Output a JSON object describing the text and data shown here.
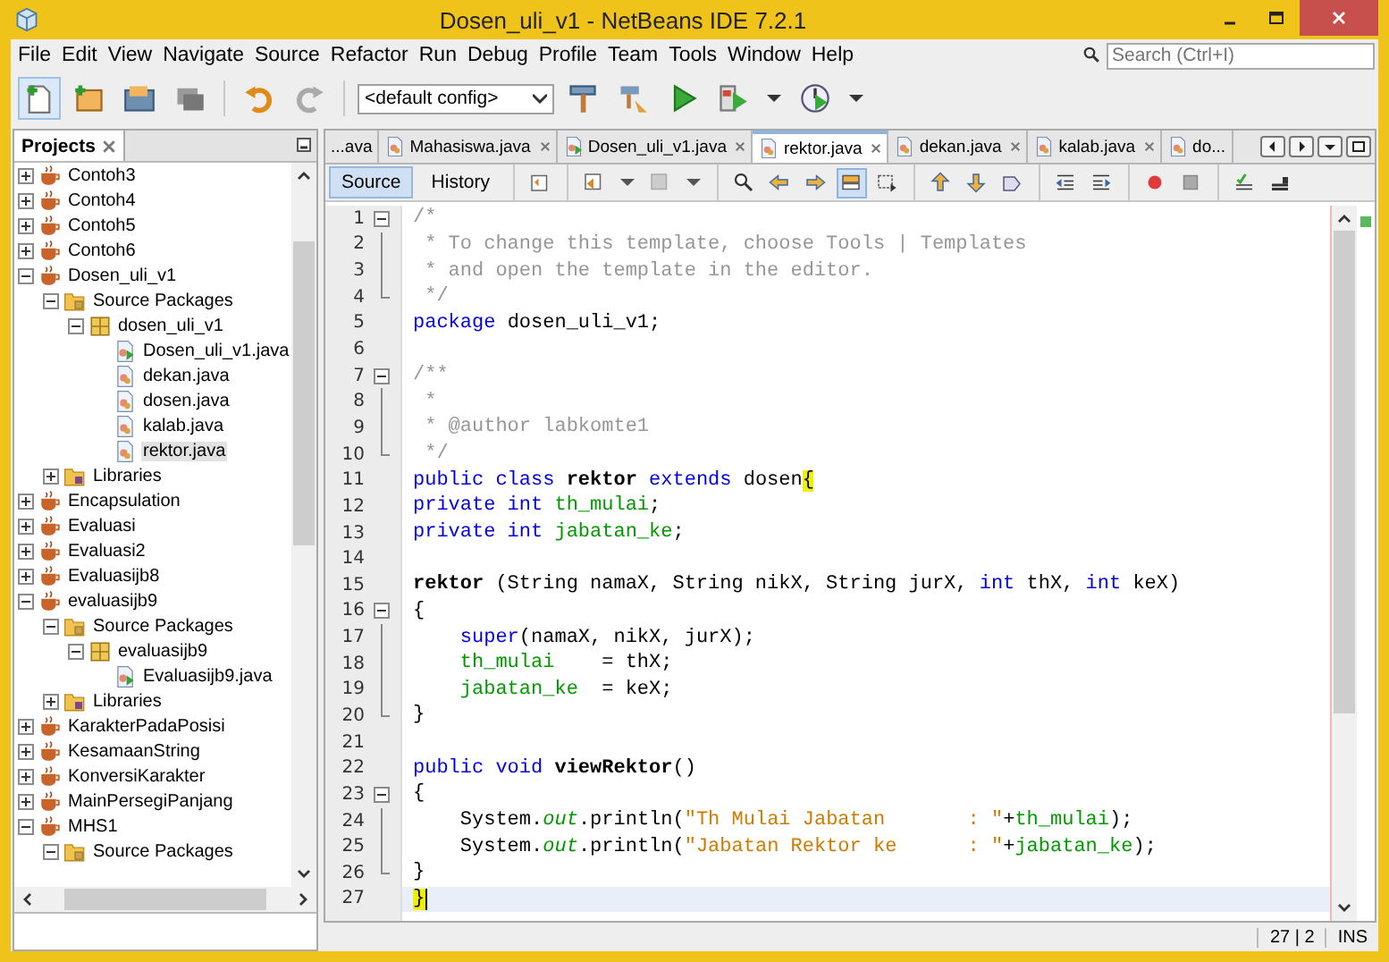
{
  "window": {
    "title": "Dosen_uli_v1 - NetBeans IDE 7.2.1"
  },
  "menu": [
    "File",
    "Edit",
    "View",
    "Navigate",
    "Source",
    "Refactor",
    "Run",
    "Debug",
    "Profile",
    "Team",
    "Tools",
    "Window",
    "Help"
  ],
  "search": {
    "placeholder": "Search (Ctrl+I)"
  },
  "toolbar": {
    "config": "<default config>"
  },
  "projects_panel": {
    "title": "Projects",
    "tree": [
      {
        "label": "Contoh3",
        "kind": "project",
        "expanded": false,
        "selected": false
      },
      {
        "label": "Contoh4",
        "kind": "project",
        "expanded": false,
        "selected": false
      },
      {
        "label": "Contoh5",
        "kind": "project",
        "expanded": false,
        "selected": false
      },
      {
        "label": "Contoh6",
        "kind": "project",
        "expanded": false,
        "selected": false
      },
      {
        "label": "Dosen_uli_v1",
        "kind": "project",
        "expanded": true,
        "selected": false,
        "children": [
          {
            "label": "Source Packages",
            "kind": "sources",
            "expanded": true,
            "selected": false,
            "children": [
              {
                "label": "dosen_uli_v1",
                "kind": "package",
                "expanded": true,
                "selected": false,
                "children": [
                  {
                    "label": "Dosen_uli_v1.java",
                    "kind": "main",
                    "selected": false
                  },
                  {
                    "label": "dekan.java",
                    "kind": "java",
                    "selected": false
                  },
                  {
                    "label": "dosen.java",
                    "kind": "java",
                    "selected": false
                  },
                  {
                    "label": "kalab.java",
                    "kind": "java",
                    "selected": false
                  },
                  {
                    "label": "rektor.java",
                    "kind": "java",
                    "selected": true
                  }
                ]
              }
            ]
          },
          {
            "label": "Libraries",
            "kind": "libraries",
            "expanded": false,
            "selected": false
          }
        ]
      },
      {
        "label": "Encapsulation",
        "kind": "project",
        "expanded": false,
        "selected": false
      },
      {
        "label": "Evaluasi",
        "kind": "project",
        "expanded": false,
        "selected": false
      },
      {
        "label": "Evaluasi2",
        "kind": "project",
        "expanded": false,
        "selected": false
      },
      {
        "label": "Evaluasijb8",
        "kind": "project",
        "expanded": false,
        "selected": false
      },
      {
        "label": "evaluasijb9",
        "kind": "project",
        "expanded": true,
        "selected": false,
        "children": [
          {
            "label": "Source Packages",
            "kind": "sources",
            "expanded": true,
            "selected": false,
            "children": [
              {
                "label": "evaluasijb9",
                "kind": "package",
                "expanded": true,
                "selected": false,
                "children": [
                  {
                    "label": "Evaluasijb9.java",
                    "kind": "main",
                    "selected": false
                  }
                ]
              }
            ]
          },
          {
            "label": "Libraries",
            "kind": "libraries",
            "expanded": false,
            "selected": false
          }
        ]
      },
      {
        "label": "KarakterPadaPosisi",
        "kind": "project",
        "expanded": false,
        "selected": false
      },
      {
        "label": "KesamaanString",
        "kind": "project",
        "expanded": false,
        "selected": false
      },
      {
        "label": "KonversiKarakter",
        "kind": "project",
        "expanded": false,
        "selected": false
      },
      {
        "label": "MainPersegiPanjang",
        "kind": "project",
        "expanded": false,
        "selected": false
      },
      {
        "label": "MHS1",
        "kind": "project",
        "expanded": true,
        "selected": false,
        "children": [
          {
            "label": "Source Packages",
            "kind": "sources",
            "expanded": true,
            "selected": false
          }
        ]
      }
    ]
  },
  "editor_tabs": [
    {
      "label": "...ava",
      "kind": "none",
      "selected": false
    },
    {
      "label": "Mahasiswa.java",
      "kind": "java",
      "selected": false
    },
    {
      "label": "Dosen_uli_v1.java",
      "kind": "main",
      "selected": false
    },
    {
      "label": "rektor.java",
      "kind": "java",
      "selected": true
    },
    {
      "label": "dekan.java",
      "kind": "java",
      "selected": false
    },
    {
      "label": "kalab.java",
      "kind": "java",
      "selected": false
    },
    {
      "label": "do...",
      "kind": "java",
      "selected": false
    }
  ],
  "view_tabs": [
    {
      "label": "Source",
      "selected": true
    },
    {
      "label": "History",
      "selected": false
    }
  ],
  "code": {
    "lines": [
      {
        "number": "1",
        "kind": "fold_start",
        "current": false,
        "tokens": [
          {
            "t": "/*",
            "kind": "comment"
          }
        ]
      },
      {
        "number": "2",
        "kind": "fold_body",
        "current": false,
        "tokens": [
          {
            "t": " * To change this template, choose Tools | Templates",
            "kind": "comment"
          }
        ]
      },
      {
        "number": "3",
        "kind": "fold_body",
        "current": false,
        "tokens": [
          {
            "t": " * and open the template in the editor.",
            "kind": "comment"
          }
        ]
      },
      {
        "number": "4",
        "kind": "fold_end",
        "current": false,
        "tokens": [
          {
            "t": " */",
            "kind": "comment"
          }
        ]
      },
      {
        "number": "5",
        "kind": "plain",
        "current": false,
        "tokens": [
          {
            "t": "package",
            "kind": "keyword"
          },
          {
            "t": " dosen_uli_v1;",
            "kind": "plain"
          }
        ]
      },
      {
        "number": "6",
        "kind": "plain",
        "current": false
      },
      {
        "number": "7",
        "kind": "fold_start",
        "current": false,
        "tokens": [
          {
            "t": "/**",
            "kind": "comment"
          }
        ]
      },
      {
        "number": "8",
        "kind": "fold_body",
        "current": false,
        "tokens": [
          {
            "t": " *",
            "kind": "comment"
          }
        ]
      },
      {
        "number": "9",
        "kind": "fold_body",
        "current": false,
        "tokens": [
          {
            "t": " * @author labkomte1",
            "kind": "comment"
          }
        ]
      },
      {
        "number": "10",
        "kind": "fold_end",
        "current": false,
        "tokens": [
          {
            "t": " */",
            "kind": "comment"
          }
        ]
      },
      {
        "number": "11",
        "kind": "plain",
        "current": false,
        "tokens": [
          {
            "t": "public class",
            "kind": "keyword"
          },
          {
            "t": " rektor",
            "kind": "bold"
          },
          {
            "t": " extends",
            "kind": "keyword"
          },
          {
            "t": " dosen",
            "kind": "plain"
          },
          {
            "t": "{",
            "kind": "match"
          }
        ]
      },
      {
        "number": "12",
        "kind": "plain",
        "current": false,
        "tokens": [
          {
            "t": "private int",
            "kind": "keyword"
          },
          {
            "t": " th_mulai",
            "kind": "field"
          },
          {
            "t": ";",
            "kind": "plain"
          }
        ]
      },
      {
        "number": "13",
        "kind": "plain",
        "current": false,
        "tokens": [
          {
            "t": "private int",
            "kind": "keyword"
          },
          {
            "t": " jabatan_ke",
            "kind": "field"
          },
          {
            "t": ";",
            "kind": "plain"
          }
        ]
      },
      {
        "number": "14",
        "kind": "plain",
        "current": false
      },
      {
        "number": "15",
        "kind": "plain",
        "current": false,
        "tokens": [
          {
            "t": "rektor",
            "kind": "bold"
          },
          {
            "t": " (String namaX, String nikX, String jurX, ",
            "kind": "plain"
          },
          {
            "t": "int",
            "kind": "keyword"
          },
          {
            "t": " thX, ",
            "kind": "plain"
          },
          {
            "t": "int",
            "kind": "keyword"
          },
          {
            "t": " keX)",
            "kind": "plain"
          }
        ]
      },
      {
        "number": "16",
        "kind": "fold_start",
        "current": false,
        "tokens": [
          {
            "t": "{",
            "kind": "plain"
          }
        ]
      },
      {
        "number": "17",
        "kind": "fold_body",
        "current": false,
        "tokens": [
          {
            "t": "    super",
            "kind": "keyword"
          },
          {
            "t": "(namaX, nikX, jurX);",
            "kind": "plain"
          }
        ]
      },
      {
        "number": "18",
        "kind": "fold_body",
        "current": false,
        "tokens": [
          {
            "t": "    th_mulai",
            "kind": "field"
          },
          {
            "t": "    = thX;",
            "kind": "plain"
          }
        ]
      },
      {
        "number": "19",
        "kind": "fold_body",
        "current": false,
        "tokens": [
          {
            "t": "    jabatan_ke",
            "kind": "field"
          },
          {
            "t": "  = keX;",
            "kind": "plain"
          }
        ]
      },
      {
        "number": "20",
        "kind": "fold_end",
        "current": false,
        "tokens": [
          {
            "t": "}",
            "kind": "plain"
          }
        ]
      },
      {
        "number": "21",
        "kind": "plain",
        "current": false
      },
      {
        "number": "22",
        "kind": "plain",
        "current": false,
        "tokens": [
          {
            "t": "public void",
            "kind": "keyword"
          },
          {
            "t": " viewRektor",
            "kind": "bold"
          },
          {
            "t": "()",
            "kind": "plain"
          }
        ]
      },
      {
        "number": "23",
        "kind": "fold_start",
        "current": false,
        "tokens": [
          {
            "t": "{",
            "kind": "plain"
          }
        ]
      },
      {
        "number": "24",
        "kind": "fold_body",
        "current": false,
        "tokens": [
          {
            "t": "    System.",
            "kind": "plain"
          },
          {
            "t": "out",
            "kind": "static"
          },
          {
            "t": ".println(",
            "kind": "plain"
          },
          {
            "t": "\"Th Mulai Jabatan       : \"",
            "kind": "string"
          },
          {
            "t": "+",
            "kind": "plain"
          },
          {
            "t": "th_mulai",
            "kind": "field"
          },
          {
            "t": ");",
            "kind": "plain"
          }
        ]
      },
      {
        "number": "25",
        "kind": "fold_body",
        "current": false,
        "tokens": [
          {
            "t": "    System.",
            "kind": "plain"
          },
          {
            "t": "out",
            "kind": "static"
          },
          {
            "t": ".println(",
            "kind": "plain"
          },
          {
            "t": "\"Jabatan Rektor ke      : \"",
            "kind": "string"
          },
          {
            "t": "+",
            "kind": "plain"
          },
          {
            "t": "jabatan_ke",
            "kind": "field"
          },
          {
            "t": ");",
            "kind": "plain"
          }
        ]
      },
      {
        "number": "26",
        "kind": "fold_end",
        "current": false,
        "tokens": [
          {
            "t": "}",
            "kind": "plain"
          }
        ]
      },
      {
        "number": "27",
        "kind": "plain",
        "current": true,
        "tokens": [
          {
            "t": "}",
            "kind": "match"
          }
        ]
      }
    ]
  },
  "status_bar": {
    "position": "27 | 2",
    "mode": "INS"
  }
}
